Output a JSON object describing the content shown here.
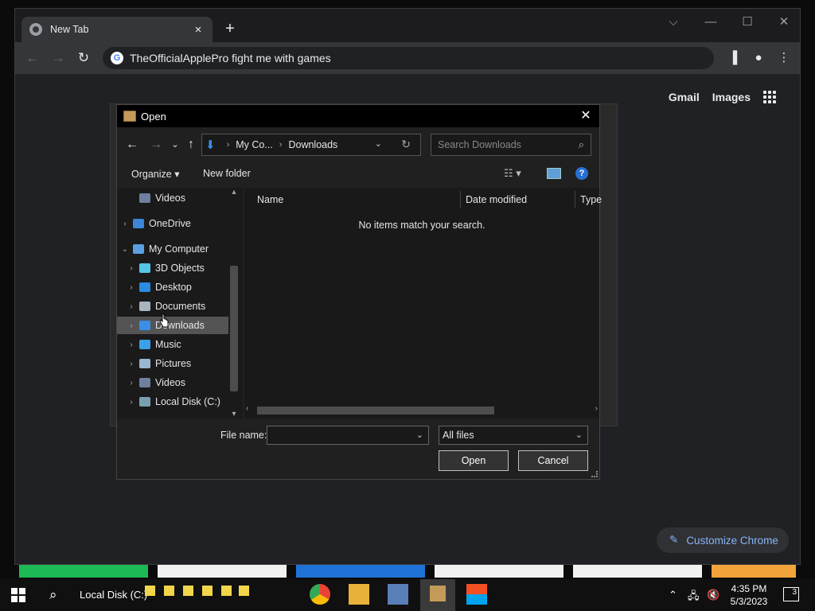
{
  "browser": {
    "tab_title": "New Tab",
    "tab_close": "×",
    "new_tab": "+",
    "omnibox_text": "TheOfficialApplePro fight me with games",
    "google_letter": "G",
    "links": [
      "Gmail",
      "Images"
    ],
    "customize_label": "Customize Chrome",
    "window_controls": [
      "⌵",
      "—",
      "☐",
      "✕"
    ]
  },
  "dialog": {
    "title": "Open",
    "close": "✕",
    "breadcrumb": [
      "My Co...",
      "Downloads"
    ],
    "search_placeholder": "Search Downloads",
    "organize_label": "Organize ▾",
    "new_folder_label": "New folder",
    "help": "?",
    "tree": [
      {
        "label": "Videos",
        "indent": 2,
        "chevron": "",
        "color": "#6f7f9f"
      },
      {
        "label": "OneDrive",
        "indent": 1,
        "chevron": "›",
        "color": "#3b86d8"
      },
      {
        "label": "My Computer",
        "indent": 1,
        "chevron": "⌄",
        "color": "#5aa0e0"
      },
      {
        "label": "3D Objects",
        "indent": 2,
        "chevron": "›",
        "color": "#56c6e6"
      },
      {
        "label": "Desktop",
        "indent": 2,
        "chevron": "›",
        "color": "#2a8be0"
      },
      {
        "label": "Documents",
        "indent": 2,
        "chevron": "›",
        "color": "#aab4c0"
      },
      {
        "label": "Downloads",
        "indent": 2,
        "chevron": "›",
        "color": "#3a8ee6",
        "selected": true
      },
      {
        "label": "Music",
        "indent": 2,
        "chevron": "›",
        "color": "#3ba0e8"
      },
      {
        "label": "Pictures",
        "indent": 2,
        "chevron": "›",
        "color": "#9ab6d0"
      },
      {
        "label": "Videos",
        "indent": 2,
        "chevron": "›",
        "color": "#6f7f9f"
      },
      {
        "label": "Local Disk (C:)",
        "indent": 2,
        "chevron": "›",
        "color": "#7aa0b0"
      }
    ],
    "columns": [
      "Name",
      "Date modified",
      "Type"
    ],
    "empty_message": "No items match your search.",
    "file_name_label": "File name:",
    "file_name_value": "",
    "file_type": "All files",
    "open_button": "Open",
    "cancel_button": "Cancel"
  },
  "taskbar": {
    "search_label": "Local Disk (C:)",
    "time": "4:35 PM",
    "date": "5/3/2023",
    "notification_count": "3"
  }
}
